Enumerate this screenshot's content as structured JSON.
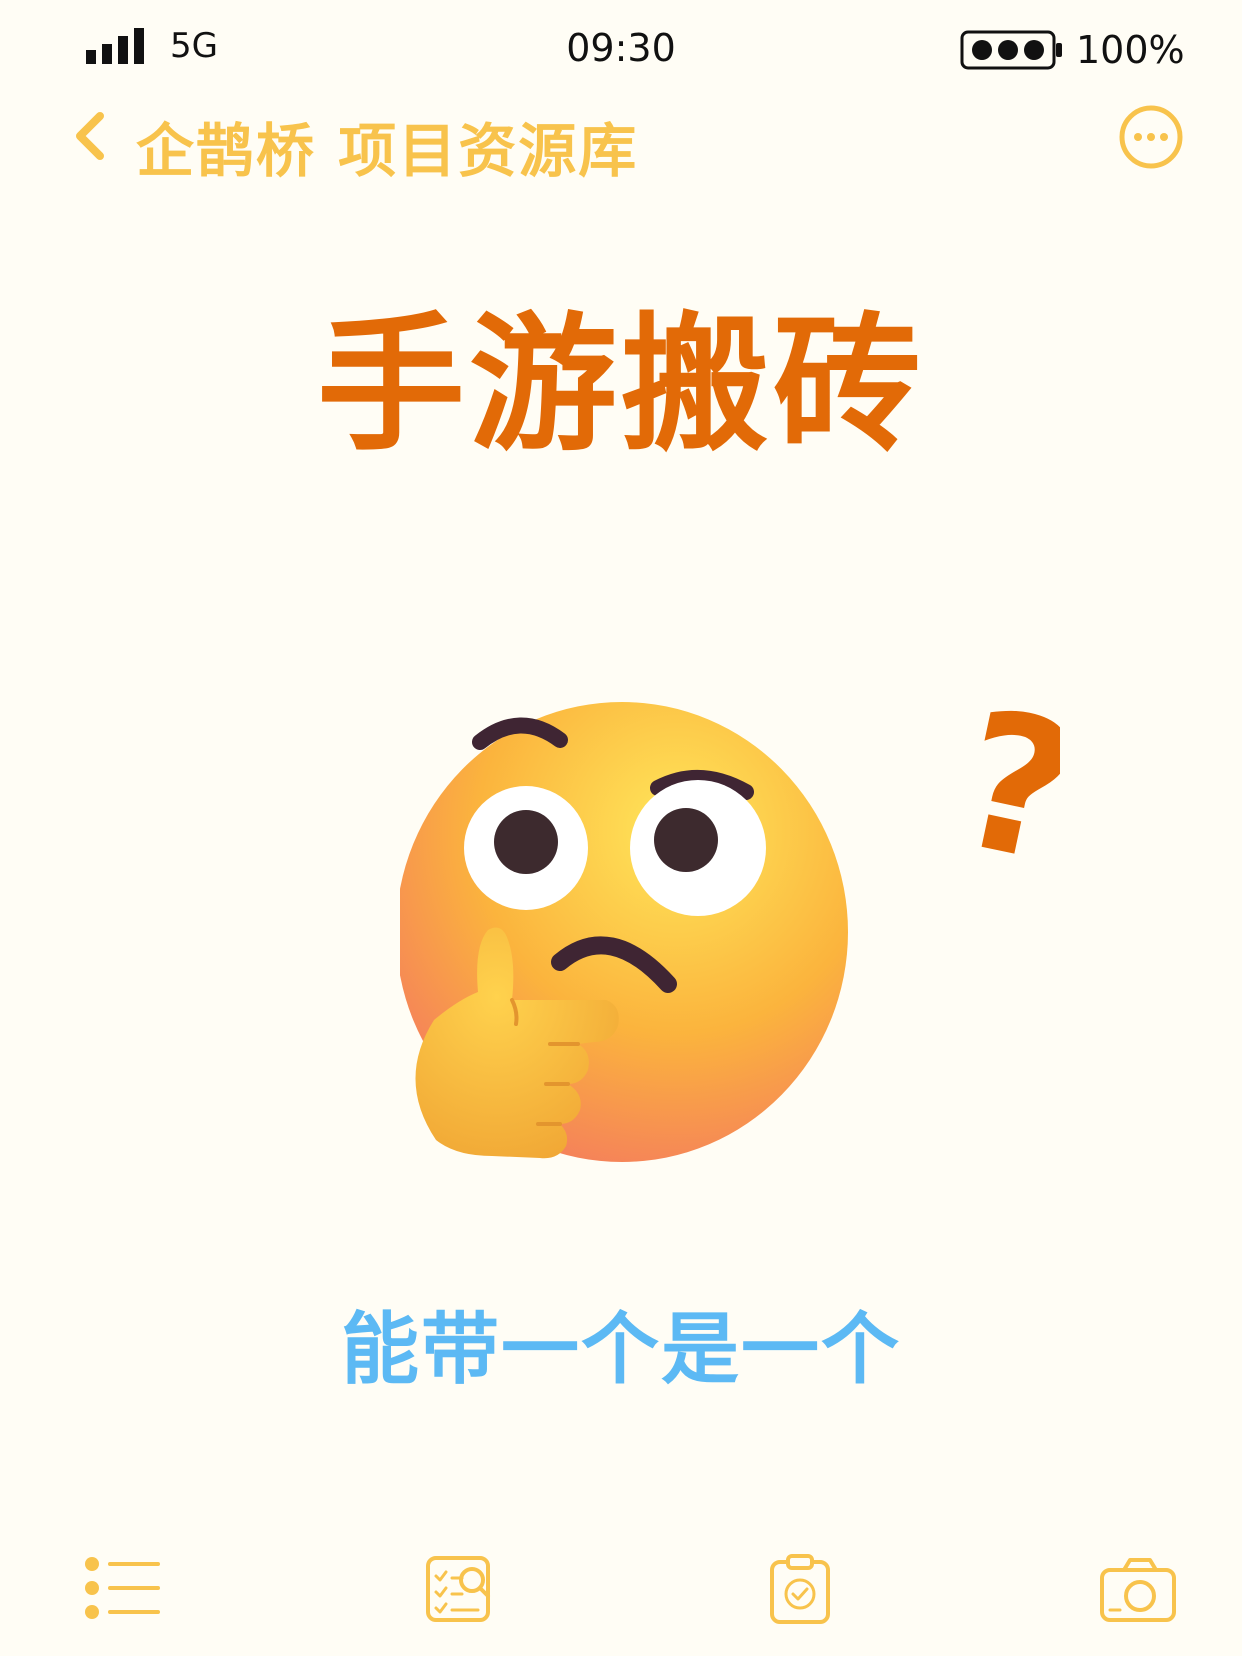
{
  "status_bar": {
    "network": "5G",
    "time": "09:30",
    "battery_percent": "100%"
  },
  "nav": {
    "title": "企鹊桥 项目资源库",
    "back_icon": "chevron-left-icon",
    "more_icon": "more-circle-icon"
  },
  "content": {
    "headline": "手游搬砖",
    "subline": "能带一个是一个",
    "question_mark": "?",
    "emoji": "thinking-face-emoji"
  },
  "tabs": [
    {
      "icon": "list-icon"
    },
    {
      "icon": "checklist-search-icon"
    },
    {
      "icon": "clipboard-check-icon"
    },
    {
      "icon": "camera-icon"
    }
  ],
  "colors": {
    "background": "#fffdf5",
    "accent_yellow": "#f8c34c",
    "headline_orange": "#e26a07",
    "subline_blue": "#5cb9f4"
  }
}
